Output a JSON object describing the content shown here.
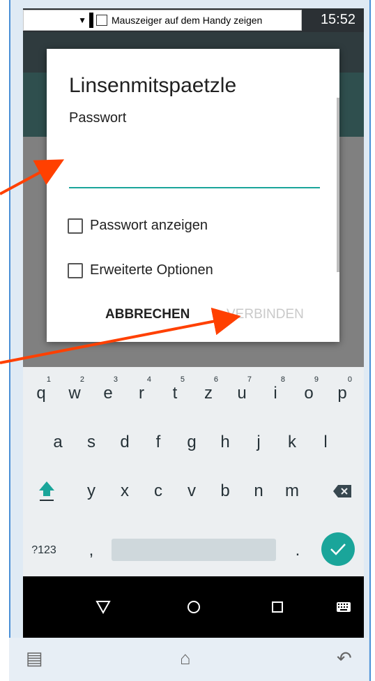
{
  "status_bar": {
    "time": "15:52"
  },
  "mirror_control": {
    "checkbox_label": "Mauszeiger auf dem Handy zeigen"
  },
  "dialog": {
    "title": "Linsenmitspaetzle",
    "password_label": "Passwort",
    "password_value": "",
    "show_password_label": "Passwort anzeigen",
    "advanced_options_label": "Erweiterte Optionen",
    "cancel_label": "ABBRECHEN",
    "connect_label": "VERBINDEN"
  },
  "keyboard": {
    "row1": [
      {
        "k": "q",
        "n": "1"
      },
      {
        "k": "w",
        "n": "2"
      },
      {
        "k": "e",
        "n": "3"
      },
      {
        "k": "r",
        "n": "4"
      },
      {
        "k": "t",
        "n": "5"
      },
      {
        "k": "z",
        "n": "6"
      },
      {
        "k": "u",
        "n": "7"
      },
      {
        "k": "i",
        "n": "8"
      },
      {
        "k": "o",
        "n": "9"
      },
      {
        "k": "p",
        "n": "0"
      }
    ],
    "row2": [
      "a",
      "s",
      "d",
      "f",
      "g",
      "h",
      "j",
      "k",
      "l"
    ],
    "row3": [
      "y",
      "x",
      "c",
      "v",
      "b",
      "n",
      "m"
    ],
    "symbols_label": "?123",
    "comma": ",",
    "period": ".",
    "enter_icon": "check-icon",
    "shift_icon": "shift-icon",
    "backspace_icon": "backspace-icon"
  },
  "nav_bar": {
    "back_icon": "triangle-back-icon",
    "home_icon": "circle-home-icon",
    "recents_icon": "square-recents-icon",
    "keyboard_icon": "keyboard-icon"
  },
  "bottom_bar": {
    "menu_icon": "menu-icon",
    "home_icon": "home-icon",
    "back_icon": "back-arrow-icon"
  },
  "colors": {
    "accent": "#1aa59a",
    "annotation_arrow": "#ff4000"
  }
}
